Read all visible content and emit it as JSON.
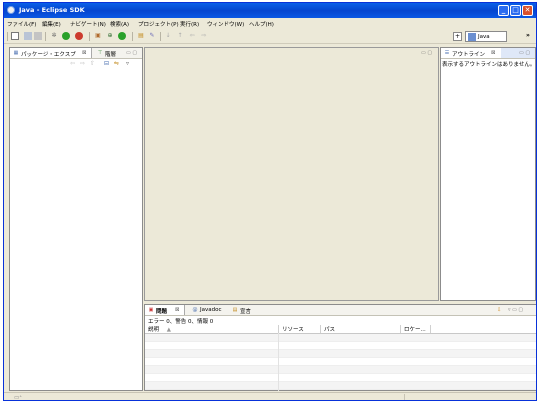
{
  "window": {
    "title": "Java - Eclipse SDK",
    "controls": {
      "minimize": "_",
      "maximize": "□",
      "close": "✕"
    }
  },
  "menu": [
    "ファイル(F)",
    "編集(E)",
    "ナビゲート(N)",
    "検索(A)",
    "プロジェクト(P)",
    "実行(R)",
    "ウィンドウ(W)",
    "ヘルプ(H)"
  ],
  "perspective": {
    "label": "Java",
    "more": "»"
  },
  "package_explorer": {
    "tabs": [
      {
        "label": "パッケージ・エクスプ",
        "close": "⊠"
      },
      {
        "label": "階層"
      }
    ]
  },
  "outline": {
    "tab_label": "アウトライン",
    "close": "⊠",
    "message": "表示するアウトラインはありません。"
  },
  "problems": {
    "tabs": [
      {
        "label": "問題",
        "close": "⊠"
      },
      {
        "label": "Javadoc"
      },
      {
        "label": "宣言"
      }
    ],
    "summary": "エラー 0、警告 0、情報 0",
    "columns": [
      "説明",
      "リソース",
      "パス",
      "ロケー..."
    ],
    "sort_indicator": "▲"
  },
  "icons": {
    "window": "eclipse-icon",
    "perspective": "java-perspective-icon",
    "status": "fast-view-icon"
  }
}
